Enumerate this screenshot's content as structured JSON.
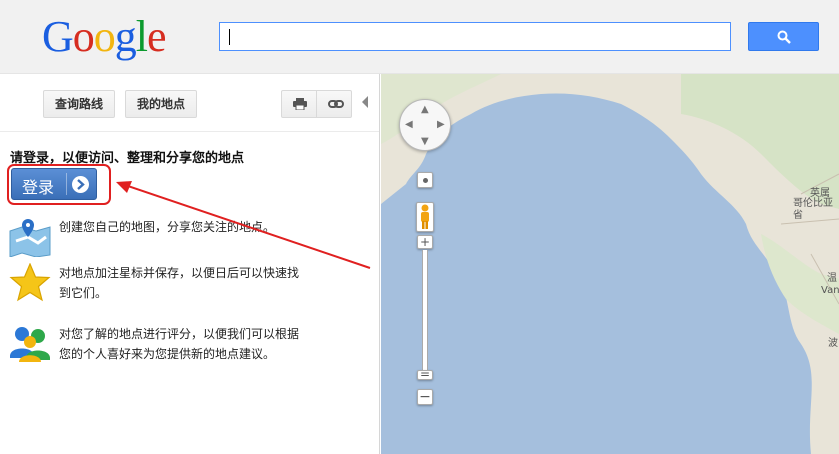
{
  "header": {
    "logo": {
      "letters": [
        "G",
        "o",
        "o",
        "g",
        "l",
        "e"
      ],
      "colors": [
        "#1a5ee0",
        "#d62d20",
        "#f2b50f",
        "#1a5ee0",
        "#0c9a2e",
        "#d62d20"
      ]
    },
    "search": {
      "value": "",
      "placeholder": ""
    },
    "search_button_icon": "search-icon"
  },
  "panel": {
    "toolbar": {
      "directions_label": "查询路线",
      "my_places_label": "我的地点",
      "print_icon": "print-icon",
      "link_icon": "link-icon"
    },
    "signin_prompt": "请登录，以便访问、整理和分享您的地点",
    "signin_button_label": "登录",
    "features": [
      {
        "icon": "custom-map-icon",
        "text": "创建您自己的地图，分享您关注的地点。"
      },
      {
        "icon": "star-icon",
        "lines": [
          "对地点加注星标并保存，以便日后可以快速找",
          "到它们。"
        ]
      },
      {
        "icon": "people-icon",
        "lines": [
          "对您了解的地点进行评分，以便我们可以根据",
          "您的个人喜好来为您提供新的地点建议。"
        ]
      }
    ]
  },
  "map": {
    "labels": [
      {
        "text": "英属"
      },
      {
        "text": "哥伦比亚省"
      },
      {
        "text": "温"
      },
      {
        "text": "Vanc"
      },
      {
        "text": "波"
      }
    ],
    "colors": {
      "water": "#a5bfdd",
      "land": "#e8e4d8",
      "highlight": "#e02020"
    }
  }
}
